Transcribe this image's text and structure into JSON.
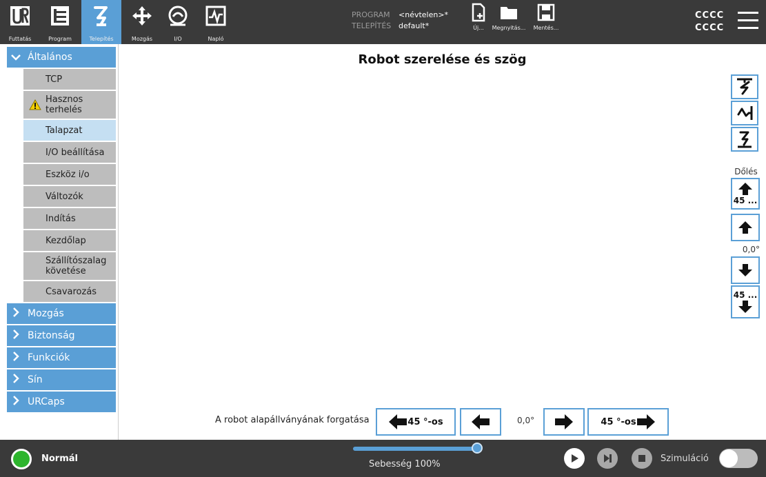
{
  "topbar": {
    "nav": [
      {
        "label": "Futtatás",
        "icon": "ur-logo-icon"
      },
      {
        "label": "Program",
        "icon": "program-tree-icon"
      },
      {
        "label": "Telepítés",
        "icon": "robot-arm-icon"
      },
      {
        "label": "Mozgás",
        "icon": "move-arrows-icon"
      },
      {
        "label": "I/O",
        "icon": "io-icon"
      },
      {
        "label": "Napló",
        "icon": "log-chart-icon"
      }
    ],
    "program_key": "PROGRAM",
    "program_value": "<névtelen>*",
    "install_key": "TELEPÍTÉS",
    "install_value": "default*",
    "new_label": "Új...",
    "open_label": "Megnyitás...",
    "save_label": "Mentés...",
    "user_line1": "CCCC",
    "user_line2": "CCCC"
  },
  "sidebar": {
    "general": "Általános",
    "items": {
      "tcp": "TCP",
      "payload": "Hasznos terhelés",
      "mounting": "Talapzat",
      "io_setup": "I/O beállítása",
      "tool_io": "Eszköz i/o",
      "variables": "Változók",
      "startup": "Indítás",
      "home": "Kezdőlap",
      "conveyor": "Szállítószalag követése",
      "screwdriving": "Csavarozás"
    },
    "sections": {
      "motion": "Mozgás",
      "safety": "Biztonság",
      "features": "Funkciók",
      "track": "Sín",
      "urcaps": "URCaps"
    }
  },
  "main": {
    "title": "Robot szerelése és szög",
    "tilt_label": "Dőlés",
    "tilt_up_45": "45 ...",
    "tilt_value": "0,0°",
    "tilt_down_45": "45 ...",
    "rotate_label": "A robot alapállványának forgatása",
    "rotate_left_45": "45 °-os",
    "rotate_value": "0,0°",
    "rotate_right_45": "45 °-os"
  },
  "footer": {
    "status": "Normál",
    "speed": "Sebesség 100%",
    "speed_fraction": 1.0,
    "simulation": "Szimuláció",
    "simulation_on": false
  },
  "colors": {
    "accent": "#5a9fd6",
    "bar": "#3a3a3a",
    "status_ok": "#2db52d",
    "submenu": "#bdbdbd",
    "submenu_selected": "#c5dff2"
  }
}
